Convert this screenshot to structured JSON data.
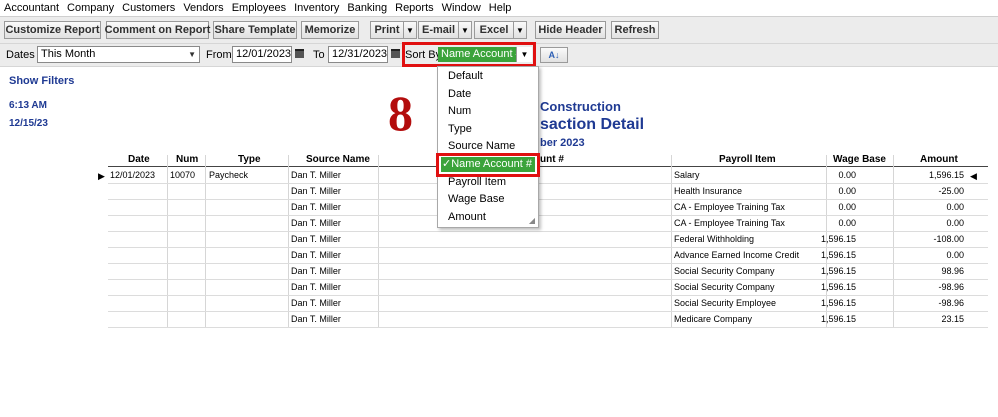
{
  "menu": [
    "Accountant",
    "Company",
    "Customers",
    "Vendors",
    "Employees",
    "Inventory",
    "Banking",
    "Reports",
    "Window",
    "Help"
  ],
  "toolbar": {
    "customize": "Customize Report",
    "comment": "Comment on Report",
    "share": "Share Template",
    "memorize": "Memorize",
    "print": "Print",
    "email": "E-mail",
    "excel": "Excel",
    "hide_header": "Hide Header",
    "refresh": "Refresh"
  },
  "filters": {
    "dates_label": "Dates",
    "dates_value": "This Month",
    "from_label": "From",
    "from_value": "12/01/2023",
    "to_label": "To",
    "to_value": "12/31/2023",
    "sortby_label": "Sort By",
    "sortby_value": "Name Account #"
  },
  "show_filters": "Show Filters",
  "report_header": {
    "time": "6:13 AM",
    "date": "12/15/23",
    "company_partial": "Construction",
    "title_partial": "saction Detail",
    "period_partial": "ber 2023"
  },
  "annotation": {
    "step": "8"
  },
  "sort_options": [
    "Default",
    "Date",
    "Num",
    "Type",
    "Source Name",
    "Name Account #",
    "Payroll Item",
    "Wage Base",
    "Amount"
  ],
  "sort_selected_index": 5,
  "columns": {
    "date": "Date",
    "num": "Num",
    "type": "Type",
    "source": "Source Name",
    "name_partial": "unt #",
    "payroll": "Payroll Item",
    "wage": "Wage Base",
    "amount": "Amount"
  },
  "rows": [
    {
      "date": "12/01/2023",
      "num": "10070",
      "type": "Paycheck",
      "source": "Dan T. Miller",
      "payroll": "Salary",
      "wage": "0.00",
      "amount": "1,596.15"
    },
    {
      "date": "",
      "num": "",
      "type": "",
      "source": "Dan T. Miller",
      "payroll": "Health Insurance",
      "wage": "0.00",
      "amount": "-25.00"
    },
    {
      "date": "",
      "num": "",
      "type": "",
      "source": "Dan T. Miller",
      "payroll": "CA - Employee Training Tax",
      "wage": "0.00",
      "amount": "0.00"
    },
    {
      "date": "",
      "num": "",
      "type": "",
      "source": "Dan T. Miller",
      "payroll": "CA - Employee Training Tax",
      "wage": "0.00",
      "amount": "0.00"
    },
    {
      "date": "",
      "num": "",
      "type": "",
      "source": "Dan T. Miller",
      "payroll": "Federal Withholding",
      "wage": "1,596.15",
      "amount": "-108.00"
    },
    {
      "date": "",
      "num": "",
      "type": "",
      "source": "Dan T. Miller",
      "payroll": "Advance Earned Income Credit",
      "wage": "1,596.15",
      "amount": "0.00"
    },
    {
      "date": "",
      "num": "",
      "type": "",
      "source": "Dan T. Miller",
      "payroll": "Social Security Company",
      "wage": "1,596.15",
      "amount": "98.96"
    },
    {
      "date": "",
      "num": "",
      "type": "",
      "source": "Dan T. Miller",
      "payroll": "Social Security Company",
      "wage": "1,596.15",
      "amount": "-98.96"
    },
    {
      "date": "",
      "num": "",
      "type": "",
      "source": "Dan T. Miller",
      "payroll": "Social Security Employee",
      "wage": "1,596.15",
      "amount": "-98.96"
    },
    {
      "date": "",
      "num": "",
      "type": "",
      "source": "Dan T. Miller",
      "payroll": "Medicare Company",
      "wage": "1,596.15",
      "amount": "23.15"
    }
  ]
}
